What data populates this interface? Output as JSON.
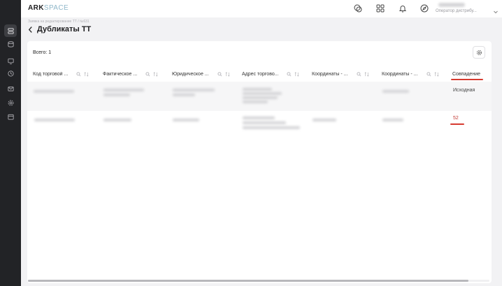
{
  "app": {
    "logo_primary": "ARK",
    "logo_secondary": "SPACE"
  },
  "topbar": {
    "icons": [
      "chat-icon",
      "apps-grid-icon",
      "bell-icon",
      "compass-icon"
    ],
    "user_role": "Оператор дистрибу..."
  },
  "sidebar": {
    "items": [
      "layers-icon",
      "database-icon",
      "monitor-icon",
      "clock-icon",
      "mail-icon",
      "settings-icon",
      "calendar-icon"
    ],
    "active_index": 0
  },
  "breadcrumb": "Заявка на редактирование ТТ  /  №631",
  "page_title": "Дубликаты ТТ",
  "total_label": "Всего: 1",
  "table": {
    "columns": [
      "Код торговой ...",
      "Фактическое ...",
      "Юридическое ...",
      "Адрес торгово...",
      "Координаты - ...",
      "Координаты - ...",
      "Совпадение"
    ],
    "rows": [
      {
        "match": "Исходная"
      },
      {
        "match": "52"
      }
    ]
  },
  "colors": {
    "accent_red": "#d63a2f",
    "sidebar_bg": "#222326"
  }
}
